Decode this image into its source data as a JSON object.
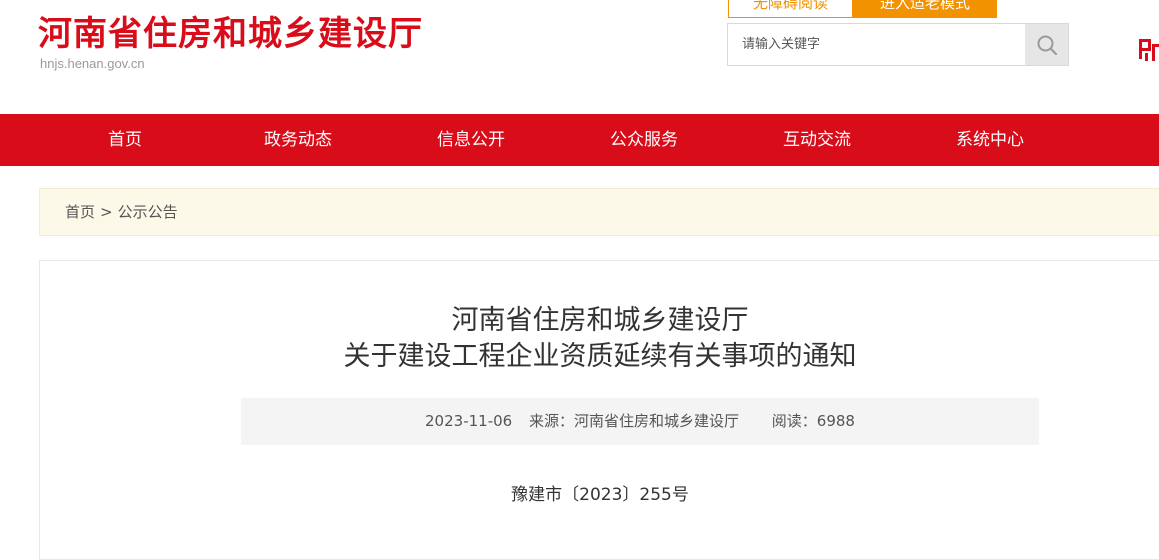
{
  "header": {
    "site_title": "河南省住房和城乡建设厅",
    "site_domain": "hnjs.henan.gov.cn",
    "accessible_button": "无障碍阅读",
    "elder_mode_button": "进入适老模式",
    "search_placeholder": "请输入关键字"
  },
  "colors": {
    "brand_red": "#d90d1a",
    "accent_orange": "#f39200",
    "breadcrumb_bg": "#fdf9e9"
  },
  "nav": {
    "items": [
      {
        "label": "首页"
      },
      {
        "label": "政务动态"
      },
      {
        "label": "信息公开"
      },
      {
        "label": "公众服务"
      },
      {
        "label": "互动交流"
      },
      {
        "label": "系统中心"
      }
    ]
  },
  "breadcrumb": {
    "home": "首页",
    "separator": ">",
    "current": "公示公告"
  },
  "article": {
    "title_line1": "河南省住房和城乡建设厅",
    "title_line2": "关于建设工程企业资质延续有关事项的通知",
    "date": "2023-11-06",
    "source": "来源：河南省住房和城乡建设厅",
    "views": "阅读：6988",
    "doc_number": "豫建市〔2023〕255号"
  },
  "icons": [
    "search-icon",
    "emblem-icon"
  ]
}
